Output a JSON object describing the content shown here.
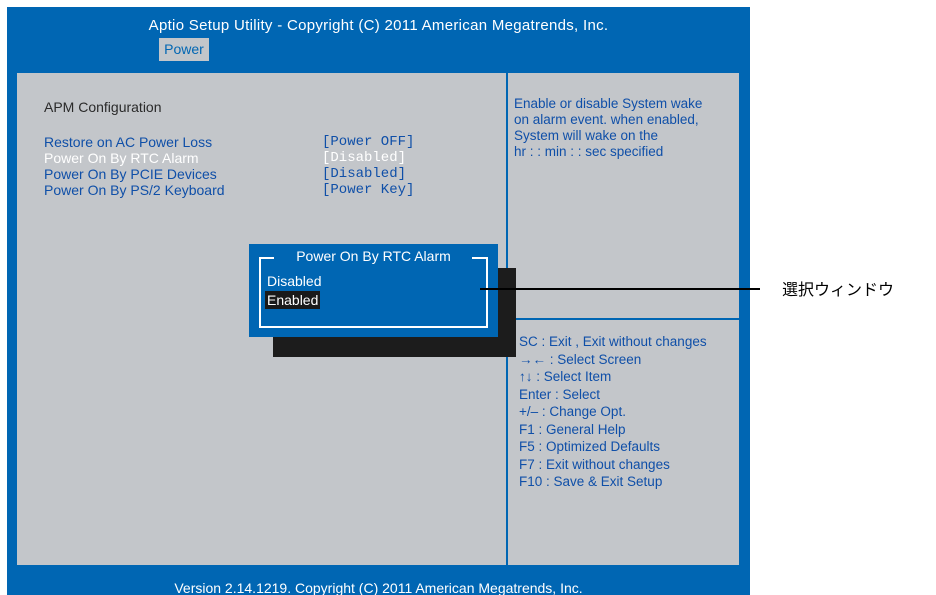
{
  "header": {
    "title": "Aptio Setup Utility - Copyright (C) 2011 American Megatrends, Inc.",
    "active_tab": "Power"
  },
  "main": {
    "section_title": "APM Configuration",
    "items": [
      {
        "label": "Restore on AC Power Loss",
        "value": "[Power OFF]"
      },
      {
        "label": "Power On By RTC Alarm",
        "value": "[Disabled]"
      },
      {
        "label": "Power On By PCIE Devices",
        "value": "[Disabled]"
      },
      {
        "label": "Power On By PS/2 Keyboard",
        "value": "[Power Key]"
      }
    ]
  },
  "help": {
    "lines": [
      "Enable or disable System wake",
      "on alarm event. when enabled,",
      "System will wake on the",
      "hr : : min : : sec specified"
    ]
  },
  "keys": [
    "SC : Exit , Exit without changes",
    "→← : Select Screen",
    "↑↓ : Select Item",
    "Enter : Select",
    "+/– : Change Opt.",
    "F1 : General Help",
    "F5 : Optimized Defaults",
    "F7 : Exit without changes",
    "F10 : Save & Exit Setup"
  ],
  "popup": {
    "title": "Power On By RTC Alarm",
    "options": [
      "Disabled",
      "Enabled"
    ],
    "selected": "Enabled"
  },
  "footer": {
    "text": "Version 2.14.1219. Copyright (C) 2011 American Megatrends, Inc."
  },
  "annotation": {
    "label": "選択ウィンドウ"
  },
  "colors": {
    "bios_blue": "#0066b3",
    "panel_gray": "#c3c6ca",
    "text_blue": "#0f4fa8"
  }
}
